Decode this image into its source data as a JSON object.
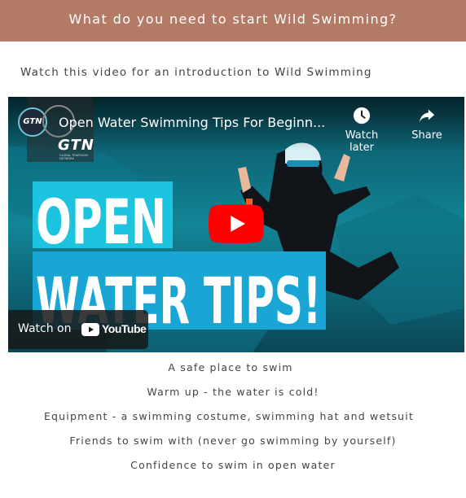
{
  "header": {
    "title": "What do you need to start Wild Swimming?"
  },
  "intro": {
    "text": "Watch this video for an introduction to Wild Swimming"
  },
  "video": {
    "channel_logo_text": "GTN",
    "channel_name": "GTN",
    "channel_tagline": "GLOBAL TRIATHLON NETWORK",
    "title": "Open Water Swimming Tips For Beginn...",
    "watch_later_label": "Watch later",
    "share_label": "Share",
    "thumbnail_line1": "OPEN",
    "thumbnail_line2": "WATER TIPS!",
    "watch_on_label": "Watch on",
    "youtube_label": "YouTube",
    "accent_red": "#ff0000",
    "water_color": "#0c6e7e"
  },
  "list": [
    "A safe place to swim",
    "Warm up - the water is cold!",
    "Equipment - a swimming costume, swimming hat and wetsuit",
    "Friends to swim with (never go swimming by yourself)",
    "Confidence to swim in open water"
  ]
}
